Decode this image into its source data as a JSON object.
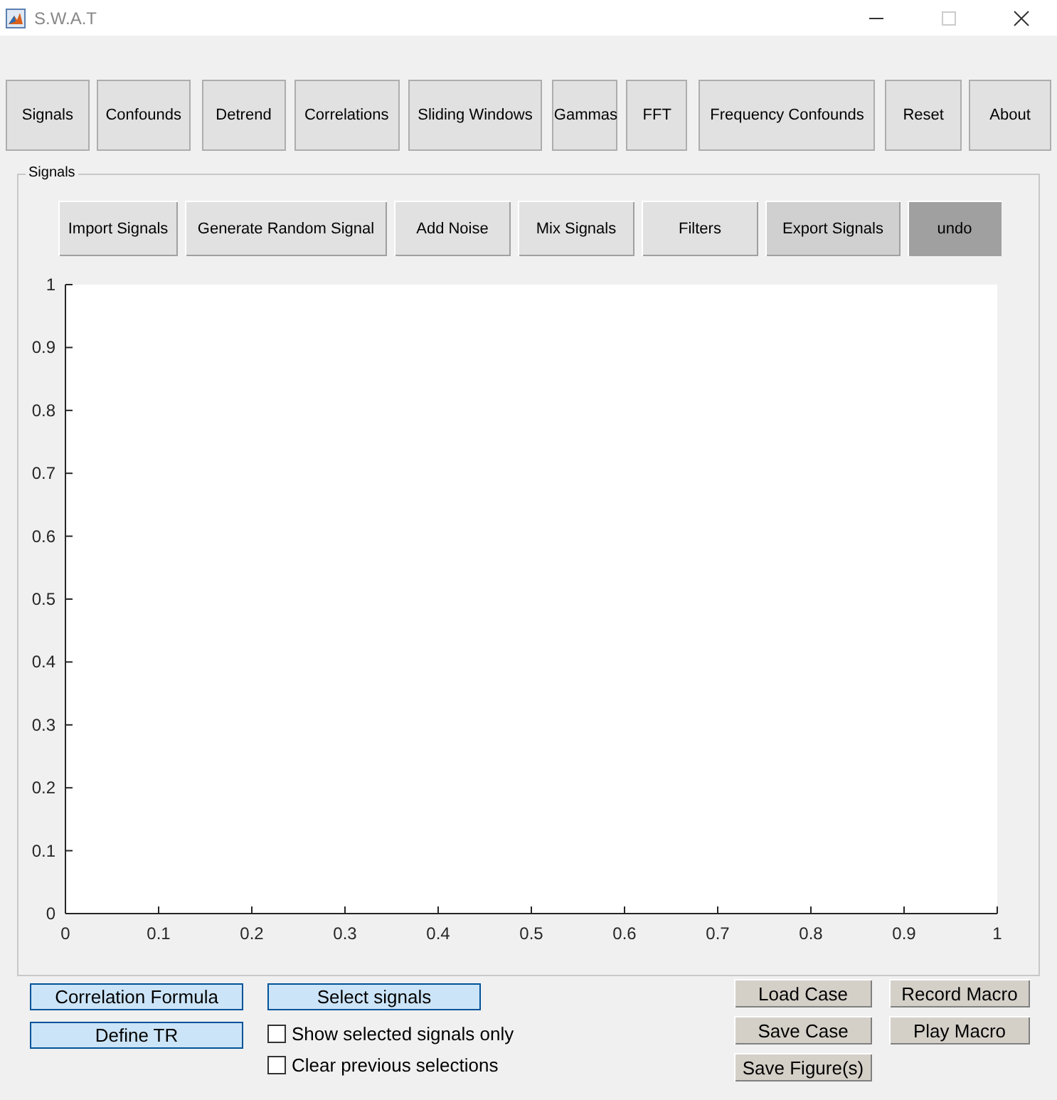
{
  "window": {
    "title": "S.W.A.T"
  },
  "tabs": [
    {
      "label": "Signals"
    },
    {
      "label": "Confounds"
    },
    {
      "label": "Detrend"
    },
    {
      "label": "Correlations"
    },
    {
      "label": "Sliding Windows"
    },
    {
      "label": "Gammas"
    },
    {
      "label": "FFT"
    },
    {
      "label": "Frequency Confounds"
    },
    {
      "label": "Reset"
    },
    {
      "label": "About"
    }
  ],
  "panel": {
    "title": "Signals",
    "buttons": [
      {
        "label": "Import Signals",
        "color": "#e1e1e1"
      },
      {
        "label": "Generate Random Signal",
        "color": "#e1e1e1"
      },
      {
        "label": "Add Noise",
        "color": "#e1e1e1"
      },
      {
        "label": "Mix Signals",
        "color": "#e1e1e1"
      },
      {
        "label": "Filters",
        "color": "#e1e1e1"
      },
      {
        "label": "Export Signals",
        "color": "#d0d0d0"
      },
      {
        "label": "undo",
        "color": "#a0a0a0"
      }
    ],
    "chart_data": {
      "type": "line",
      "xlim": [
        0,
        1
      ],
      "ylim": [
        0,
        1
      ],
      "xticks": [
        0,
        0.1,
        0.2,
        0.3,
        0.4,
        0.5,
        0.6,
        0.7,
        0.8,
        0.9,
        1
      ],
      "yticks": [
        0,
        0.1,
        0.2,
        0.3,
        0.4,
        0.5,
        0.6,
        0.7,
        0.8,
        0.9,
        1
      ]
    }
  },
  "controls": {
    "correlation_formula": "Correlation Formula",
    "define_tr": "Define TR",
    "select_signals": "Select signals",
    "checkboxes": [
      {
        "label": "Show selected signals only",
        "checked": false
      },
      {
        "label": "Clear previous selections",
        "checked": false
      }
    ],
    "case_buttons": [
      "Load Case",
      "Save Case",
      "Save Figure(s)"
    ],
    "macro_buttons": [
      "Record Macro",
      "Play Macro"
    ]
  }
}
